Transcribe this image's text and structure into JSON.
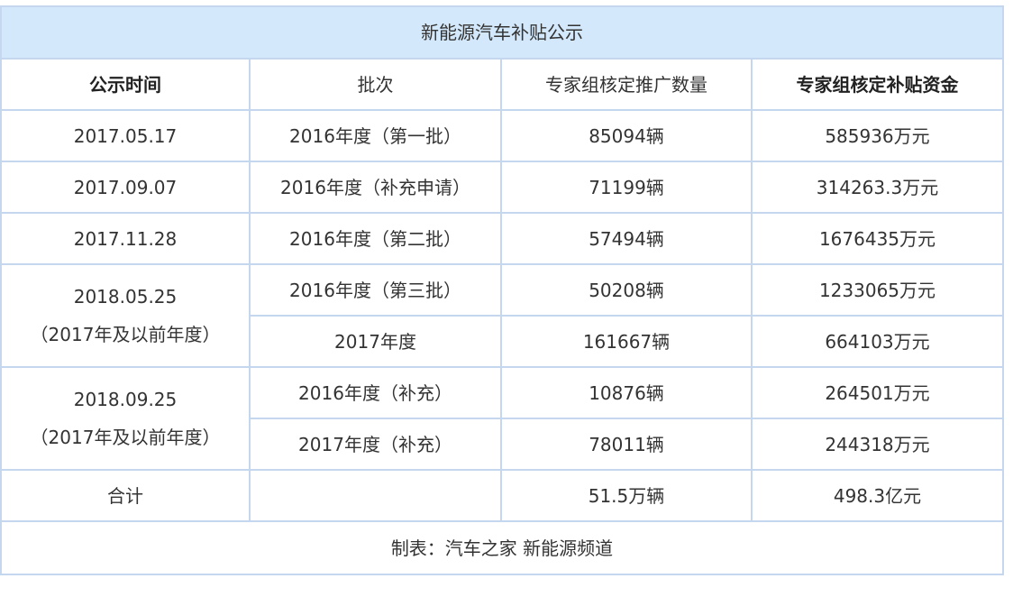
{
  "table": {
    "title": "新能源汽车补贴公示",
    "headers": [
      "公示时间",
      "批次",
      "专家组核定推广数量",
      "专家组核定补贴资金"
    ],
    "groups": [
      {
        "date": [
          "2017.05.17"
        ],
        "rows": [
          {
            "batch": "2016年度（第一批）",
            "quantity": "85094辆",
            "funds": "585936万元"
          }
        ]
      },
      {
        "date": [
          "2017.09.07"
        ],
        "rows": [
          {
            "batch": "2016年度（补充申请）",
            "quantity": "71199辆",
            "funds": "314263.3万元"
          }
        ]
      },
      {
        "date": [
          "2017.11.28"
        ],
        "rows": [
          {
            "batch": "2016年度（第二批）",
            "quantity": "57494辆",
            "funds": "1676435万元"
          }
        ]
      },
      {
        "date": [
          "2018.05.25",
          "（2017年及以前年度）"
        ],
        "rows": [
          {
            "batch": "2016年度（第三批）",
            "quantity": "50208辆",
            "funds": "1233065万元"
          },
          {
            "batch": "2017年度",
            "quantity": "161667辆",
            "funds": "664103万元"
          }
        ]
      },
      {
        "date": [
          "2018.09.25",
          "（2017年及以前年度）"
        ],
        "rows": [
          {
            "batch": "2016年度（补充）",
            "quantity": "10876辆",
            "funds": "264501万元"
          },
          {
            "batch": "2017年度（补充）",
            "quantity": "78011辆",
            "funds": "244318万元"
          }
        ]
      }
    ],
    "total": {
      "label": "合计",
      "batch": "",
      "quantity": "51.5万辆",
      "funds": "498.3亿元"
    },
    "footer": "制表：汽车之家 新能源频道"
  }
}
